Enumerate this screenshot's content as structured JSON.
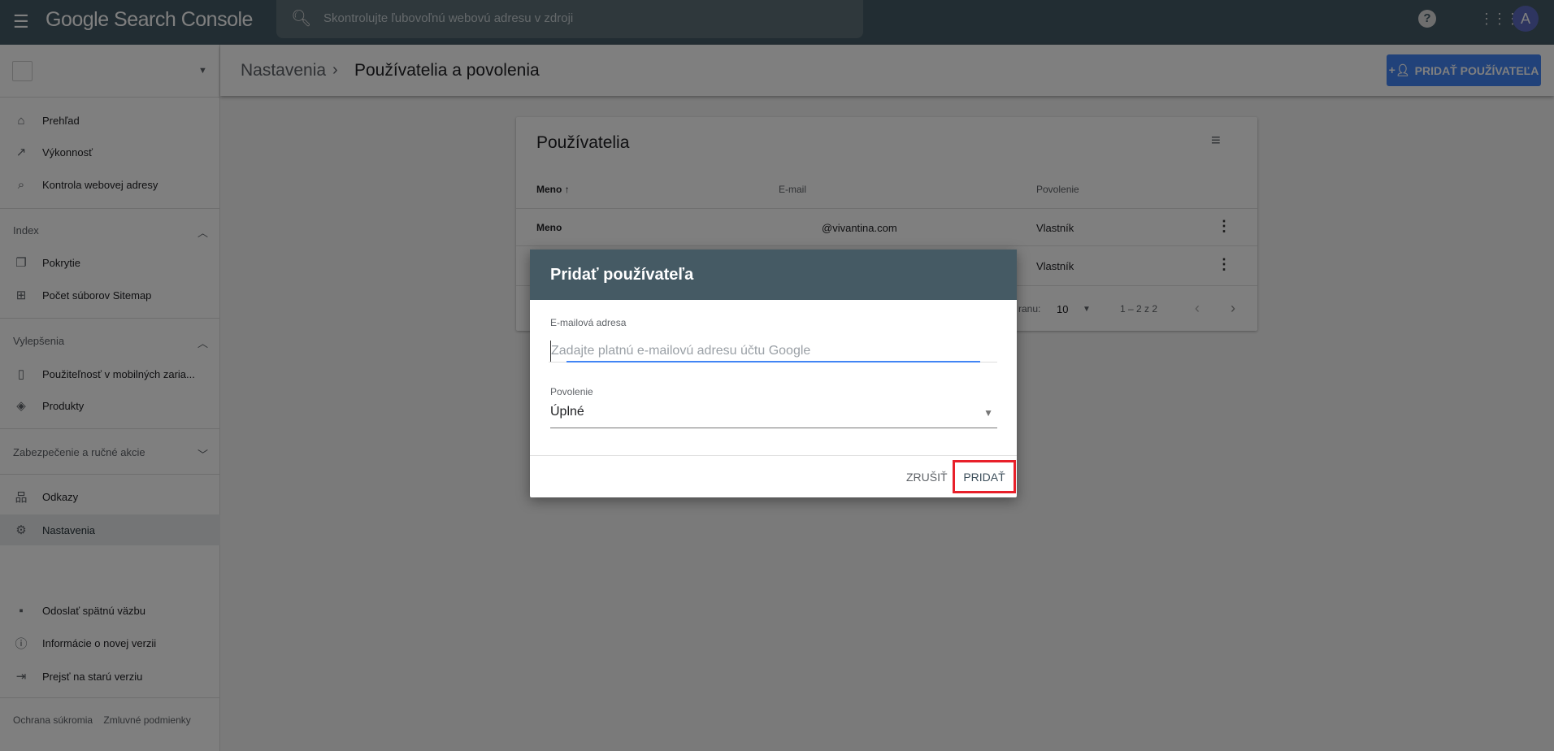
{
  "app": {
    "title": "Google Search Console",
    "search_placeholder": "Skontrolujte ľubovoľnú webovú adresu v zdroji",
    "avatar_letter": "A"
  },
  "sidebar": {
    "items": [
      {
        "label": "Prehľad",
        "icon": "home-icon"
      },
      {
        "label": "Výkonnosť",
        "icon": "trending-up-icon"
      },
      {
        "label": "Kontrola webovej adresy",
        "icon": "search-icon"
      }
    ],
    "index": {
      "title": "Index",
      "items": [
        {
          "label": "Pokrytie"
        },
        {
          "label": "Počet súborov Sitemap"
        }
      ]
    },
    "enh": {
      "title": "Vylepšenia",
      "items": [
        {
          "label": "Použiteľnosť v mobilných zaria..."
        },
        {
          "label": "Produkty"
        }
      ]
    },
    "security": {
      "title": "Zabezpečenie a ručné akcie"
    },
    "links": {
      "label": "Odkazy"
    },
    "settings": {
      "label": "Nastavenia",
      "active": true
    },
    "bottom": [
      {
        "label": "Odoslať spätnú väzbu"
      },
      {
        "label": "Informácie o novej verzii"
      },
      {
        "label": "Prejsť na starú verziu"
      }
    ],
    "footer": {
      "privacy": "Ochrana súkromia",
      "terms": "Zmluvné podmienky"
    }
  },
  "header": {
    "breadcrumb_parent": "Nastavenia",
    "breadcrumb_current": "Používatelia a povolenia",
    "add_user_button": "PRIDAŤ POUŽÍVATEĽA"
  },
  "users_card": {
    "title": "Používatelia",
    "columns": [
      "Meno",
      "E-mail",
      "Povolenie"
    ],
    "rows": [
      {
        "name": "Meno",
        "email": "@vivantina.com",
        "permission": "Vlastník"
      },
      {
        "name": "",
        "email": "",
        "permission": "Vlastník"
      }
    ],
    "footer": {
      "rows_label_fragment": "ranu:",
      "rows_per_page": "10",
      "range": "1 – 2 z 2"
    }
  },
  "dialog": {
    "title": "Pridať používateľa",
    "email_label": "E-mailová adresa",
    "email_value": "",
    "email_placeholder": "Zadajte platnú e-mailovú adresu účtu Google",
    "permission_label": "Povolenie",
    "permission_value": "Úplné",
    "cancel": "ZRUŠIŤ",
    "add": "PRIDAŤ"
  },
  "colors": {
    "topbar": "#455a66",
    "primary": "#4285f4",
    "highlight": "#e8202a"
  }
}
